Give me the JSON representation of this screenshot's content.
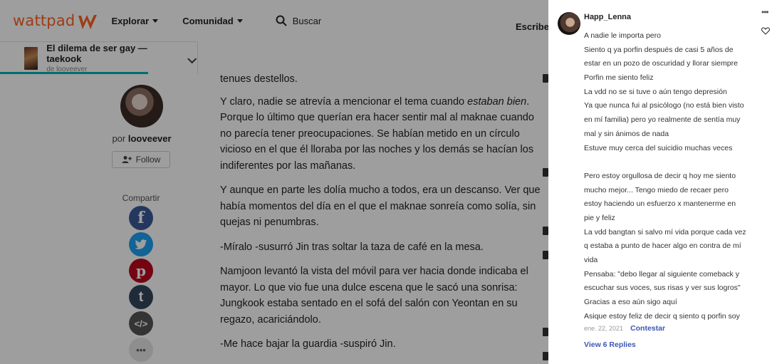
{
  "nav": {
    "logo_text": "wattpad",
    "explore_label": "Explorar",
    "community_label": "Comunidad",
    "search_label": "Buscar",
    "write_label": "Escribe"
  },
  "story": {
    "title": "El dilema de ser gay — taekook",
    "author_line": "de looveever",
    "reading_progress_percent": 27
  },
  "author": {
    "by_prefix": "por",
    "name": "looveever",
    "follow_label": "Follow"
  },
  "share": {
    "label": "Compartir",
    "icons": [
      "facebook-icon",
      "twitter-icon",
      "pinterest-icon",
      "tumblr-icon",
      "embed-icon",
      "more-icon"
    ]
  },
  "reader": {
    "paragraphs": [
      "tenues destellos.",
      "Y claro, nadie se atrevía a mencionar el tema cuando estaban bien. Porque lo último que querían era hacer sentir mal al maknae cuando no parecía tener preocupaciones. Se habían metido en un círculo vicioso en el que él lloraba por las noches y los demás se hacían los indiferentes por las mañanas.",
      "Y aunque en parte les dolía mucho a todos, era un descanso. Ver que había momentos del día en el que el maknae sonreía como solía, sin quejas ni penumbras.",
      "-Míralo -susurró Jin tras soltar la taza de café en la mesa.",
      "Namjoon levantó la vista del móvil para ver hacia donde indicaba el mayor. Lo que vio fue una dulce escena que le sacó una sonrisa: Jungkook estaba sentado en el sofá del salón con Yeontan en su regazo, acariciándolo.",
      "-Me hace bajar la guardia -suspiró Jin."
    ]
  },
  "comment": {
    "username": "Happ_Lenna",
    "lines": [
      "A nadie le importa pero",
      "Siento q ya porfin después de casi 5 años de",
      "estar en un pozo de oscuridad y llorar siempre",
      "Porfin me siento feliz",
      "La vdd no se si tuve o aún tengo depresión",
      "Ya que nunca fui al psicólogo (no está bien visto",
      "en mí familia) pero yo realmente de sentía muy",
      "mal y sin ánimos de nada",
      "Estuve muy cerca del suicidio muchas veces",
      "",
      "Pero estoy orgullosa de decir q hoy me siento",
      "mucho mejor... Tengo miedo de recaer pero",
      "estoy haciendo un esfuerzo x mantenerme en",
      "pie y feliz",
      "La vdd bangtan si salvo mí vida porque cada vez",
      "q estaba a punto de hacer algo en contra de mí",
      "vida",
      "Pensaba: \"debo llegar al siguiente comeback y",
      "escuchar sus voces, sus risas y ver sus logros\"",
      "Gracias a eso aún sigo aquí",
      "Asique estoy feliz de decir q siento q porfin soy"
    ],
    "date": "ene. 22, 2021",
    "reply_label": "Contestar",
    "view_replies_label": "View 6 Replies",
    "more_label": "•••"
  },
  "colors": {
    "brand": "#ff6122",
    "progress": "#00b2b2",
    "link": "#3b57b4",
    "facebook": "#3b5998",
    "twitter": "#1da1f2",
    "pinterest": "#bd081c",
    "tumblr": "#35465c",
    "embed": "#555555"
  }
}
